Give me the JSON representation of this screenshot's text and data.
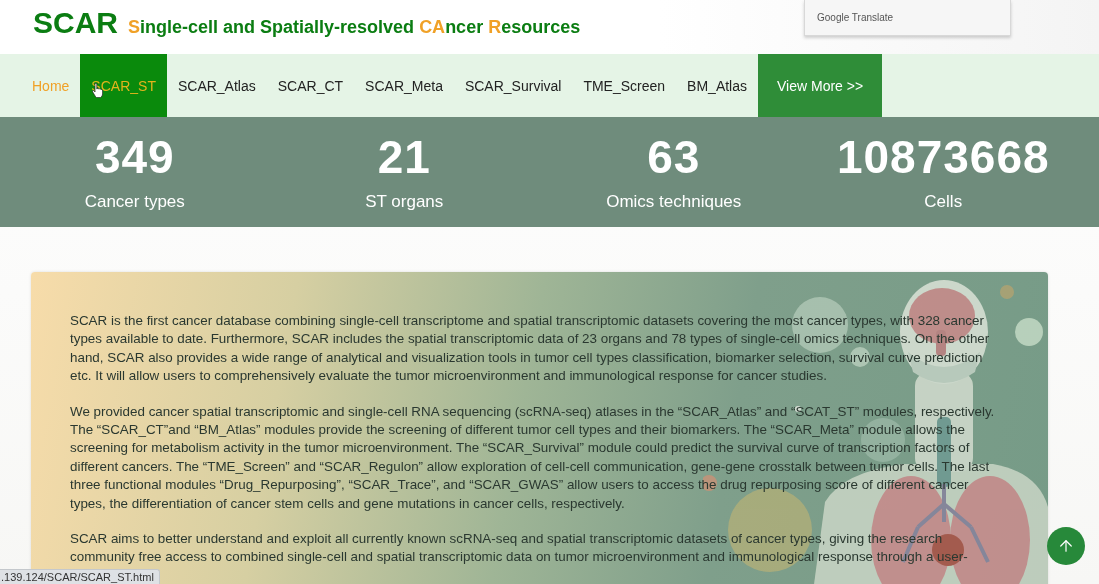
{
  "header": {
    "logo": "SCAR",
    "subtitle": [
      {
        "text": "S",
        "accent": true
      },
      {
        "text": "ingle-cell and Spatially-resolved ",
        "accent": false
      },
      {
        "text": "CA",
        "accent": true
      },
      {
        "text": "ncer ",
        "accent": false
      },
      {
        "text": "R",
        "accent": true
      },
      {
        "text": "esources",
        "accent": false
      }
    ]
  },
  "translate_widget": {
    "label": "Google Translate"
  },
  "nav": {
    "items": [
      {
        "label": "Home",
        "kind": "link",
        "selected": true,
        "hovered": false
      },
      {
        "label": "SCAR_ST",
        "kind": "link",
        "selected": false,
        "hovered": true
      },
      {
        "label": "SCAR_Atlas",
        "kind": "link",
        "selected": false,
        "hovered": false
      },
      {
        "label": "SCAR_CT",
        "kind": "link",
        "selected": false,
        "hovered": false
      },
      {
        "label": "SCAR_Meta",
        "kind": "link",
        "selected": false,
        "hovered": false
      },
      {
        "label": "SCAR_Survival",
        "kind": "link",
        "selected": false,
        "hovered": false
      },
      {
        "label": "TME_Screen",
        "kind": "link",
        "selected": false,
        "hovered": false
      },
      {
        "label": "BM_Atlas",
        "kind": "link",
        "selected": false,
        "hovered": false
      },
      {
        "label": "View More >>",
        "kind": "button",
        "selected": false,
        "hovered": false
      }
    ]
  },
  "stats": [
    {
      "value": "349",
      "label": "Cancer types"
    },
    {
      "value": "21",
      "label": "ST organs"
    },
    {
      "value": "63",
      "label": "Omics techniques"
    },
    {
      "value": "10873668",
      "label": "Cells"
    }
  ],
  "intro": {
    "paragraphs": [
      "SCAR is the first cancer database combining single-cell transcriptome and spatial transcriptomic datasets covering the most cancer types, with 328 cancer types available to date. Furthermore, SCAR includes the spatial transcriptomic data of 23 organs and 78 types of single-cell omics techniques. On the other hand, SCAR also provides a wide range of analytical and visualization tools in tumor cell types classification, biomarker selection, survival curve prediction etc. It will allow users to comprehensively evaluate the tumor microenvironment and immunological response for cancer studies.",
      "We provided cancer spatial transcriptomic and single-cell RNA sequencing (scRNA-seq) atlases in the “SCAR_Atlas” and “SCAT_ST” modules, respectively. The “SCAR_CT”and “BM_Atlas” modules provide the screening of different tumor cell types and their biomarkers. The “SCAR_Meta” module allows the screening for metabolism activity in the tumor microenvironment. The “SCAR_Survival” module could predict the survival curve of transcription factors of different cancers. The “TME_Screen” and “SCAR_Regulon” allow exploration of cell-cell communication, gene-gene crosstalk between tumor cells. The last three functional modules “Drug_Repurposing”, “SCAR_Trace”, and “SCAR_GWAS” allow users to access the drug repurposing score of different cancer types, the differentiation of cancer stem cells and gene mutations in cancer cells, respectively.",
      "SCAR aims to better understand and exploit all currently known scRNA-seq and spatial transcriptomic datasets of cancer types, giving the research community free access to combined single-cell and spatial transcriptomic data on tumor microenvironment and immunological response through a user-"
    ]
  },
  "status_bar": {
    "url": ".139.124/SCAR/SCAR_ST.html"
  }
}
